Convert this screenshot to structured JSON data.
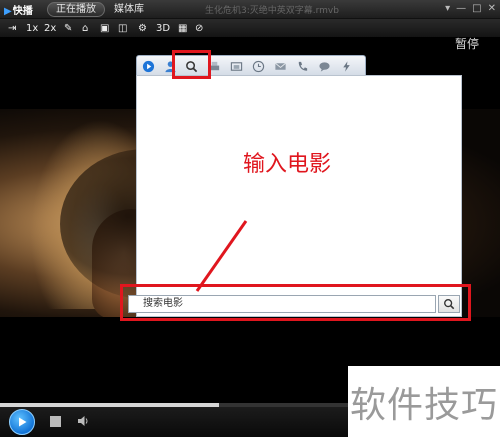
{
  "app": {
    "name": "快播",
    "title": "生化危机3:灭绝中英双字幕.rmvb"
  },
  "tabs": [
    {
      "label": "正在播放",
      "active": true
    },
    {
      "label": "媒体库",
      "active": false
    }
  ],
  "window_buttons": [
    "▾",
    "—",
    "□",
    "✕"
  ],
  "toolbar": {
    "speed_1x": "1x",
    "speed_2x": "2x",
    "mode_3d": "3D"
  },
  "status": {
    "pause_label": "暂停"
  },
  "panel": {
    "tabs": [
      "play-icon",
      "user-icon",
      "search-icon",
      "printer-icon",
      "folder-icon",
      "clock-icon",
      "mail-icon",
      "phone-icon",
      "chat-icon",
      "lightning-icon"
    ],
    "annotation": "输入电影",
    "search_placeholder": "搜索电影"
  },
  "watermark": "软件技巧",
  "playback": {
    "progress": 0.63
  },
  "colors": {
    "highlight": "#e0161e",
    "accent": "#1273d6"
  }
}
